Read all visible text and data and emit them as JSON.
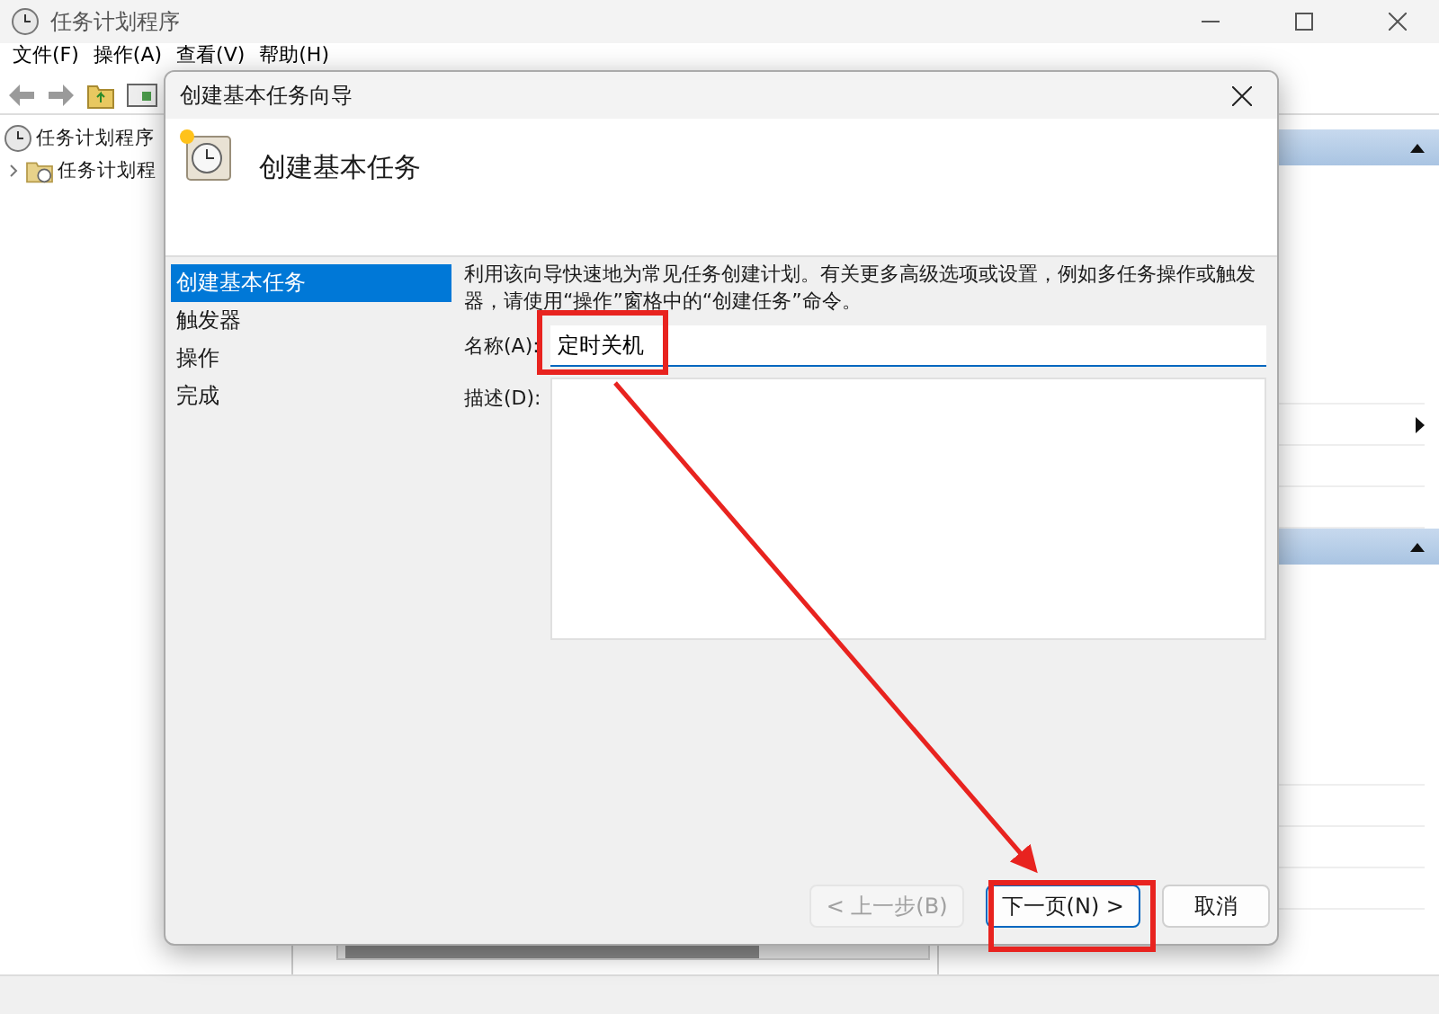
{
  "window": {
    "title": "任务计划程序",
    "menu": [
      "文件(F)",
      "操作(A)",
      "查看(V)",
      "帮助(H)"
    ]
  },
  "tree": [
    {
      "label": "任务计划程序",
      "children": [
        {
          "label": "任务计划程",
          "expanded": false
        }
      ]
    }
  ],
  "actions_pane": {
    "sections": [
      {
        "expanded": true
      },
      {
        "expanded": true
      }
    ]
  },
  "dialog": {
    "title": "创建基本任务向导",
    "heading": "创建基本任务",
    "steps": [
      {
        "label": "创建基本任务",
        "selected": true
      },
      {
        "label": "触发器",
        "selected": false
      },
      {
        "label": "操作",
        "selected": false
      },
      {
        "label": "完成",
        "selected": false
      }
    ],
    "intro": "利用该向导快速地为常见任务创建计划。有关更多高级选项或设置，例如多任务操作或触发器，请使用“操作”窗格中的“创建任务”命令。",
    "name_label": "名称(A):",
    "name_value": "定时关机",
    "desc_label": "描述(D):",
    "buttons": [
      {
        "label": "< 上一步(B)",
        "disabled": true,
        "default": false
      },
      {
        "label": "下一页(N) >",
        "disabled": false,
        "default": true
      },
      {
        "label": "取消",
        "disabled": false,
        "default": false
      }
    ]
  }
}
